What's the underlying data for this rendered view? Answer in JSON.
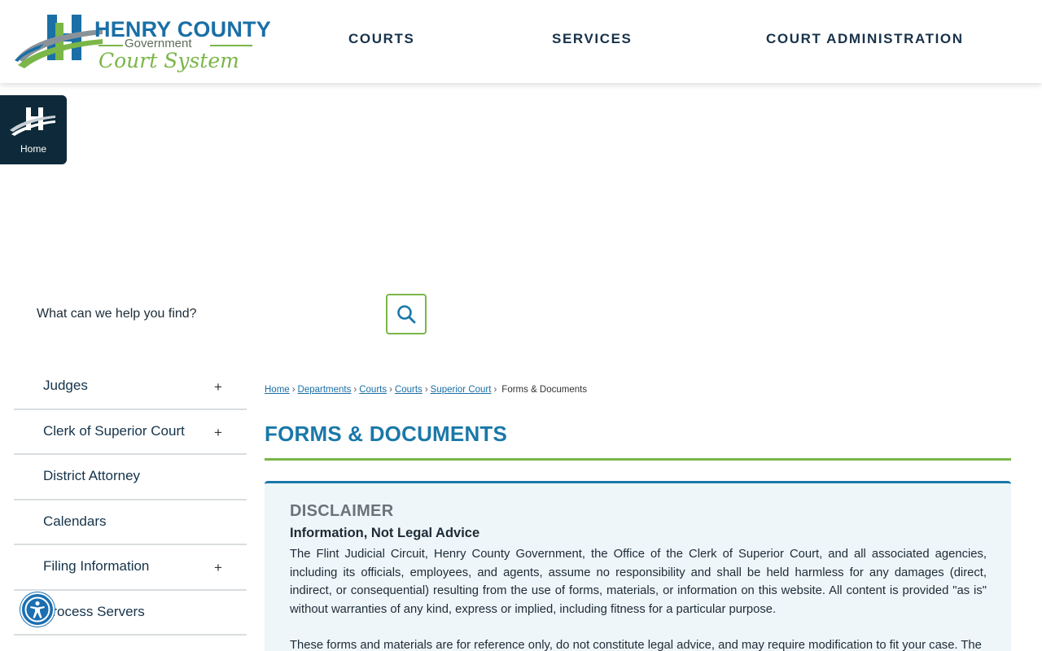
{
  "logo": {
    "title": "HENRY COUNTY",
    "subtitle": "Government",
    "script": "Court System"
  },
  "nav": {
    "courts": "COURTS",
    "services": "SERVICES",
    "court_administration": "COURT ADMINISTRATION"
  },
  "home_tile": {
    "label": "Home"
  },
  "search": {
    "placeholder": "What can we help you find?"
  },
  "sidebar": {
    "items": [
      {
        "label": "Judges",
        "expand": "+"
      },
      {
        "label": "Clerk of Superior Court",
        "expand": "+"
      },
      {
        "label": "District Attorney"
      },
      {
        "label": "Calendars"
      },
      {
        "label": "Filing Information",
        "expand": "+"
      },
      {
        "label": "Process Servers"
      }
    ]
  },
  "breadcrumb": {
    "items": [
      "Home",
      "Departments",
      "Courts",
      "Courts",
      "Superior Court"
    ],
    "current": "Forms & Documents",
    "separator": "›"
  },
  "page_title": "FORMS & DOCUMENTS",
  "disclaimer": {
    "heading": "DISCLAIMER",
    "subheading": "Information, Not Legal Advice",
    "paragraph1": "The Flint Judicial Circuit, Henry County Government, the Office of the Clerk of Superior Court, and all associated agencies, including its officials, employees, and agents, assume no responsibility and shall be held harmless for any damages (direct, indirect, or consequential) resulting from the use of forms, materials, or information on this website. All content is provided \"as is\" without warranties of any kind, express or implied, including fitness for a particular purpose.",
    "paragraph2": "These forms and materials are for reference only, do not constitute legal advice, and may require modification to fit your case. The"
  },
  "icons": {
    "search": "search-icon",
    "accessibility": "accessibility-icon",
    "home_logo": "county-h-logo-icon"
  },
  "colors": {
    "brand_blue": "#1a78a8",
    "brand_green": "#7ab648",
    "nav_text": "#18324a",
    "home_tile_bg": "#0e2a3a",
    "disclaimer_bg": "#eff6f9",
    "accessibility_blue": "#1b6fb1"
  }
}
